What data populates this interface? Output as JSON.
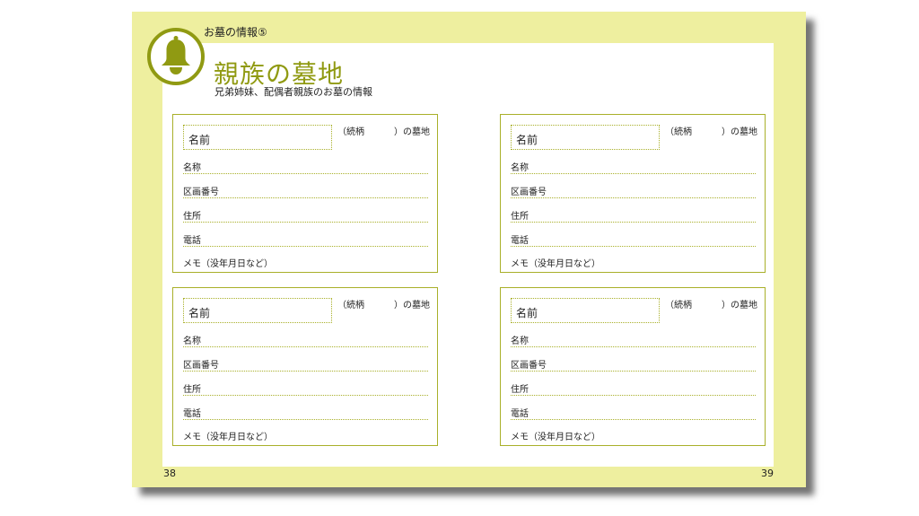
{
  "header": {
    "chapter": "お墓の情報⑤",
    "title": "親族の墓地",
    "subtitle": "兄弟姉妹、配偶者親族のお墓の情報",
    "badge_icon": "bell-icon"
  },
  "card": {
    "name_label": "名前",
    "relation_open": "（続柄",
    "relation_close": "）の墓地",
    "fields": [
      "名称",
      "区画番号",
      "住所",
      "電話",
      "メモ（没年月日など）"
    ]
  },
  "pages": {
    "left": "38",
    "right": "39"
  },
  "colors": {
    "accent": "#909a12",
    "background": "#eeef9f",
    "border": "#a9b02a"
  }
}
